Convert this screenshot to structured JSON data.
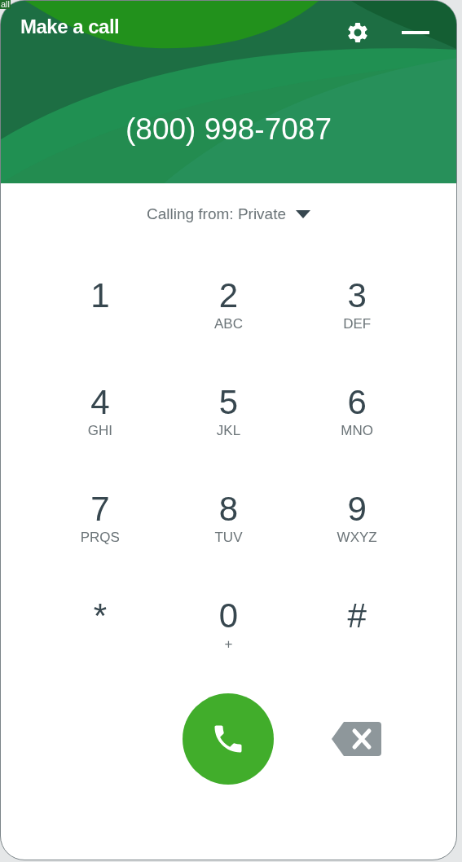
{
  "background_text": "all",
  "header": {
    "title": "Make a call",
    "number": "(800) 998-7087"
  },
  "calling_from": {
    "label": "Calling from: Private"
  },
  "keys": [
    {
      "digit": "1"
    },
    {
      "digit": "2",
      "letters": "ABC"
    },
    {
      "digit": "3",
      "letters": "DEF"
    },
    {
      "digit": "4",
      "letters": "GHI"
    },
    {
      "digit": "5",
      "letters": "JKL"
    },
    {
      "digit": "6",
      "letters": "MNO"
    },
    {
      "digit": "7",
      "letters": "PRQS"
    },
    {
      "digit": "8",
      "letters": "TUV"
    },
    {
      "digit": "9",
      "letters": "WXYZ"
    },
    {
      "digit": "*"
    },
    {
      "digit": "0",
      "letters": "+"
    },
    {
      "digit": "#"
    }
  ]
}
